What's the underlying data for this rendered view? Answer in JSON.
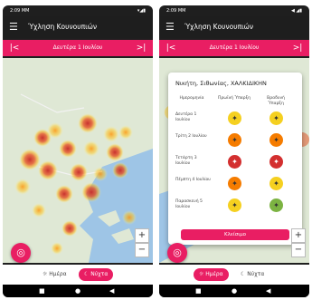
{
  "status": {
    "time": "2:09 ΜΜ",
    "icons_left": "▾◢▮",
    "icons_right": "◀ ◢▮"
  },
  "app": {
    "title": "Ύχληση Κουνουπιών"
  },
  "date_label": "Δευτέρα 1 Ιουλίου",
  "nav": {
    "prev_icon": "prev-icon",
    "next_icon": "next-icon"
  },
  "toggle": {
    "day_label": "Ημέρα",
    "night_label": "Νύχτα"
  },
  "zoom": {
    "plus": "+",
    "minus": "−"
  },
  "navbar": {
    "back": "■",
    "home": "●",
    "recents": "◀"
  },
  "colors": {
    "accent": "#e91e63",
    "red": "#d32f2f",
    "orange": "#f57c00",
    "yellow": "#f5d020",
    "green": "#7cb342",
    "sea": "#9ec5e6"
  },
  "dialog": {
    "title": "Νικήτη, Σιθωνίας, ΧΑΛΚΙΔΙΚΗΝ",
    "col_headers": [
      "Ημερομηνία",
      "Πρωϊνή Ύπαρξη",
      "Βραδυνή Ύπαρξη"
    ],
    "rows": [
      {
        "label": "Δευτέρα 1 Ιουλίου",
        "morning": "yellow",
        "evening": "yellow"
      },
      {
        "label": "Τρίτη 2 Ιουλίου",
        "morning": "orange",
        "evening": "orange"
      },
      {
        "label": "Τετάρτη 3 Ιουλίου",
        "morning": "red",
        "evening": "red"
      },
      {
        "label": "Πέμπτη 4 Ιουλίου",
        "morning": "orange",
        "evening": "yellow"
      },
      {
        "label": "Παρασκευή 5 Ιουλίου",
        "morning": "yellow",
        "evening": "green"
      }
    ],
    "close_label": "Κλείσιμο"
  }
}
